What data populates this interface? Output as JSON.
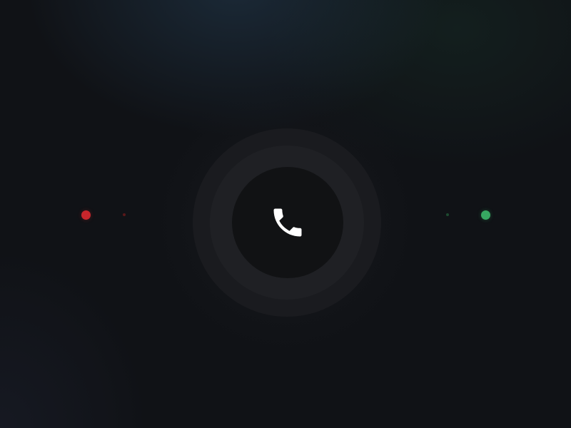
{
  "colors": {
    "background": "#101216",
    "decline": "#c8262c",
    "accept": "#37a862",
    "icon": "#ffffff"
  },
  "call": {
    "icon": "phone-handset-icon"
  },
  "decline": {
    "indicator": "decline-target"
  },
  "accept": {
    "indicator": "accept-target"
  }
}
